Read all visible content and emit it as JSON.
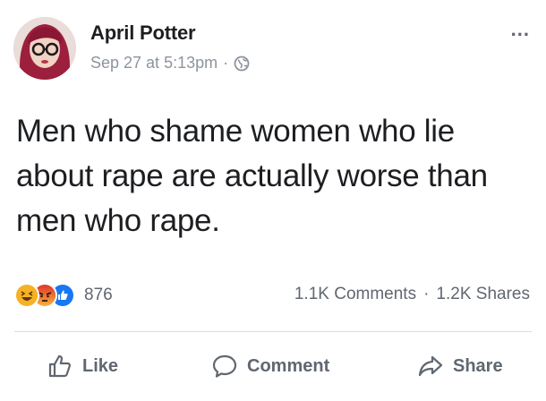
{
  "post": {
    "author": "April Potter",
    "timestamp": "Sep 27 at 5:13pm",
    "separator": "·",
    "privacy_icon": "globe-icon",
    "more_label": "...",
    "text": "Men who shame women who lie about rape are actually worse than men who rape."
  },
  "engagement": {
    "reaction_icons": [
      "haha-icon",
      "angry-icon",
      "like-icon"
    ],
    "reaction_count": "876",
    "comments": "1.1K Comments",
    "dot": "·",
    "shares": "1.2K Shares"
  },
  "actions": {
    "like_label": "Like",
    "comment_label": "Comment",
    "share_label": "Share"
  },
  "colors": {
    "text_primary": "#1c1e21",
    "text_secondary": "#606770",
    "meta_gray": "#8d949e",
    "like_blue": "#1877f2",
    "angry_red": "#e9710f",
    "haha_yellow": "#f7b125",
    "divider": "#dadde1"
  }
}
